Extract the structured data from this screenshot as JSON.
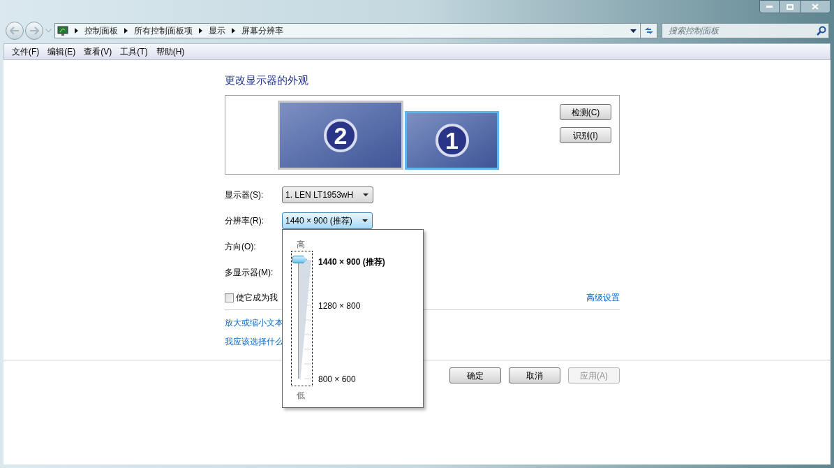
{
  "address_bar": {
    "crumbs": [
      "控制面板",
      "所有控制面板项",
      "显示",
      "屏幕分辨率"
    ]
  },
  "search": {
    "placeholder": "搜索控制面板"
  },
  "menu": [
    "文件(F)",
    "编辑(E)",
    "查看(V)",
    "工具(T)",
    "帮助(H)"
  ],
  "heading": "更改显示器的外观",
  "monitors": [
    {
      "number": "2",
      "selected": false
    },
    {
      "number": "1",
      "selected": true
    }
  ],
  "side_buttons": [
    "检测(C)",
    "识别(I)"
  ],
  "fields": [
    {
      "label": "显示器(S):",
      "value": "1. LEN LT1953wH",
      "open": false
    },
    {
      "label": "分辨率(R):",
      "value": "1440 × 900 (推荐)",
      "open": true
    },
    {
      "label": "方向(O):"
    },
    {
      "label": "多显示器(M):"
    }
  ],
  "primary_checkbox": {
    "label": "使它成为我",
    "checked": false
  },
  "advanced_link": "高级设置",
  "links": [
    "放大或缩小文本",
    "我应该选择什么"
  ],
  "buttons": [
    {
      "label": "确定",
      "disabled": false
    },
    {
      "label": "取消",
      "disabled": false
    },
    {
      "label": "应用(A)",
      "disabled": true
    }
  ],
  "resolution_popup": {
    "high_label": "高",
    "low_label": "低",
    "level": 1,
    "options": [
      {
        "label": "1440 × 900 (推荐)",
        "selected": true
      },
      {
        "label": "1280 × 800",
        "selected": false
      },
      {
        "label": "800 × 600",
        "selected": false
      }
    ]
  }
}
